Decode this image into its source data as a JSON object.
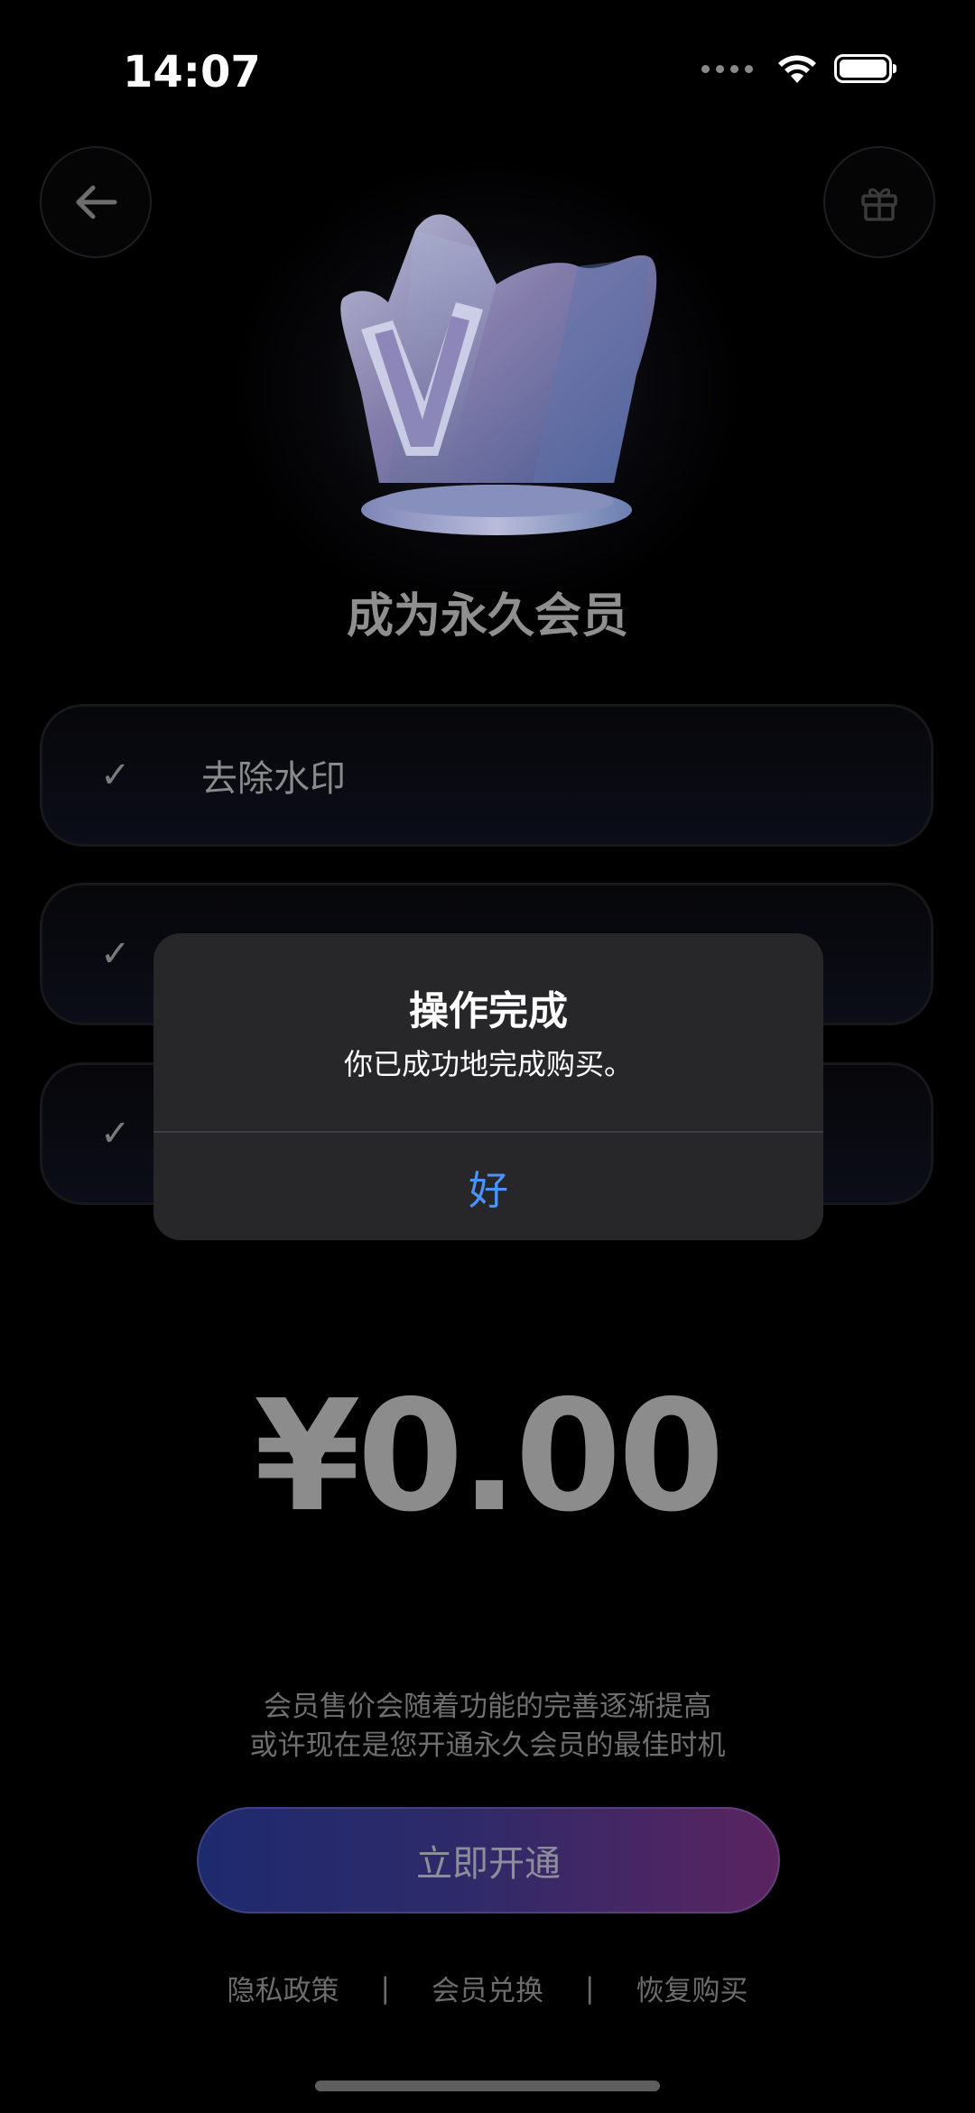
{
  "status_bar": {
    "time": "14:07"
  },
  "header": {
    "back_icon": "arrow-left-icon",
    "gift_icon": "gift-icon"
  },
  "main": {
    "title": "成为永久会员",
    "features": [
      {
        "label": "去除水印",
        "icon": "checkmark-icon"
      },
      {
        "label": "",
        "icon": "checkmark-icon"
      },
      {
        "label": "",
        "icon": "checkmark-icon"
      }
    ],
    "price": "¥0.00",
    "note_line1": "会员售价会随着功能的完善逐渐提高",
    "note_line2": "或许现在是您开通永久会员的最佳时机",
    "cta_label": "立即开通",
    "links": {
      "privacy": "隐私政策",
      "redeem": "会员兑换",
      "restore": "恢复购买",
      "separator": "|"
    }
  },
  "alert": {
    "title": "操作完成",
    "message": "你已成功地完成购买。",
    "ok_label": "好"
  },
  "colors": {
    "alert_button": "#4c93ff",
    "background": "#000000",
    "cta_gradient_start": "#1e2a6e",
    "cta_gradient_end": "#5a2460"
  }
}
